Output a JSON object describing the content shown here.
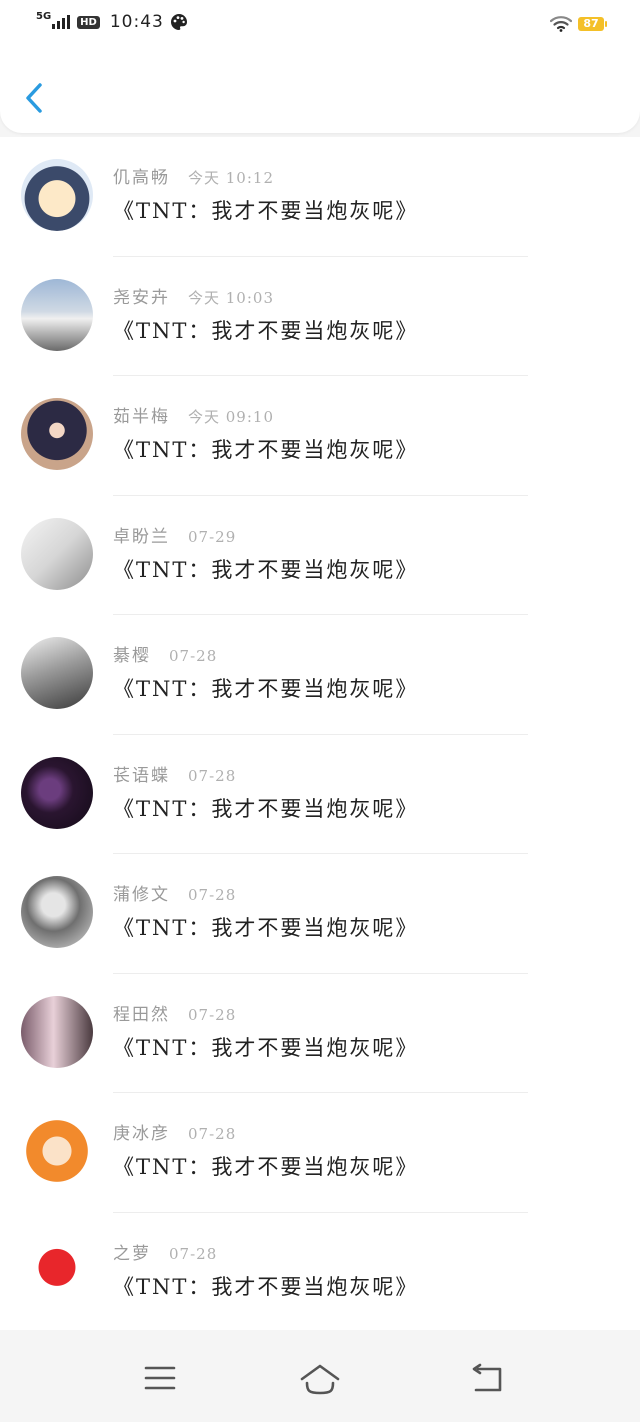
{
  "status_bar": {
    "network": "5G",
    "hd": "HD",
    "time": "10:43",
    "battery": "87",
    "battery_color": "#f4c028"
  },
  "header": {
    "back_icon": "chevron-left-icon",
    "accent": "#2a9be0"
  },
  "messages": [
    {
      "name": "仉高畅",
      "time": "今天 10:12",
      "text": "《TNT：我才不要当炮灰呢》",
      "avatar": "cartoon-boy-avatar"
    },
    {
      "name": "尧安卉",
      "time": "今天 10:03",
      "text": "《TNT：我才不要当炮灰呢》",
      "avatar": "white-car-avatar"
    },
    {
      "name": "茹半梅",
      "time": "今天 09:10",
      "text": "《TNT：我才不要当炮灰呢》",
      "avatar": "girl-purple-hoodie-avatar"
    },
    {
      "name": "卓盼兰",
      "time": "07-29",
      "text": "《TNT：我才不要当炮灰呢》",
      "avatar": "woman-profile-avatar"
    },
    {
      "name": "綦樱",
      "time": "07-28",
      "text": "《TNT：我才不要当炮灰呢》",
      "avatar": "bw-man-photo-avatar"
    },
    {
      "name": "苌语蝶",
      "time": "07-28",
      "text": "《TNT：我才不要当炮灰呢》",
      "avatar": "dark-purple-abstract-avatar"
    },
    {
      "name": "蒲修文",
      "time": "07-28",
      "text": "《TNT：我才不要当炮灰呢》",
      "avatar": "bw-sunglasses-avatar"
    },
    {
      "name": "程田然",
      "time": "07-28",
      "text": "《TNT：我才不要当炮灰呢》",
      "avatar": "couple-photo-avatar"
    },
    {
      "name": "庚冰彦",
      "time": "07-28",
      "text": "《TNT：我才不要当炮灰呢》",
      "avatar": "orange-hair-anime-girl-avatar"
    },
    {
      "name": "之萝",
      "time": "07-28",
      "text": "《TNT：我才不要当炮灰呢》",
      "avatar": "red-mascot-avatar"
    }
  ],
  "nav": {
    "menu_icon": "menu-icon",
    "home_icon": "home-icon",
    "back_icon": "back-arrow-icon"
  }
}
